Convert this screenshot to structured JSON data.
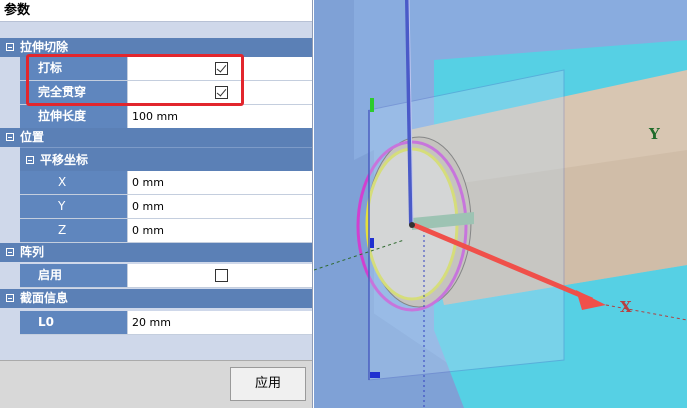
{
  "panel": {
    "title": "参数",
    "extrude_cut": {
      "header": "拉伸切除",
      "rows": [
        {
          "label": "打标",
          "checked": true
        },
        {
          "label": "完全贯穿",
          "checked": true
        },
        {
          "label": "拉伸长度",
          "value": "100 mm"
        }
      ]
    },
    "position": {
      "header": "位置",
      "translate": {
        "header": "平移坐标",
        "rows": [
          {
            "label": "X",
            "value": "0 mm"
          },
          {
            "label": "Y",
            "value": "0 mm"
          },
          {
            "label": "Z",
            "value": "0 mm"
          }
        ]
      }
    },
    "array": {
      "header": "阵列",
      "rows": [
        {
          "label": "启用",
          "checked": false
        }
      ]
    },
    "section_info": {
      "header": "截面信息",
      "rows": [
        {
          "label": "L0",
          "value": "20 mm"
        }
      ]
    },
    "apply_label": "应用"
  },
  "viewport": {
    "axis_labels": {
      "x": "X",
      "y": "Y"
    },
    "colors": {
      "background": "#7fa1d6",
      "cyan_region": "#56d0e4",
      "tube_fill": "#d8c6b2",
      "x_arrow": "#f0504a",
      "plane": "#a8c8f0",
      "ring_yellow": "#f0e040",
      "ring_magenta": "#d040d0",
      "y_axis_label": "#1f6b2a",
      "x_axis_label": "#b84040"
    }
  }
}
